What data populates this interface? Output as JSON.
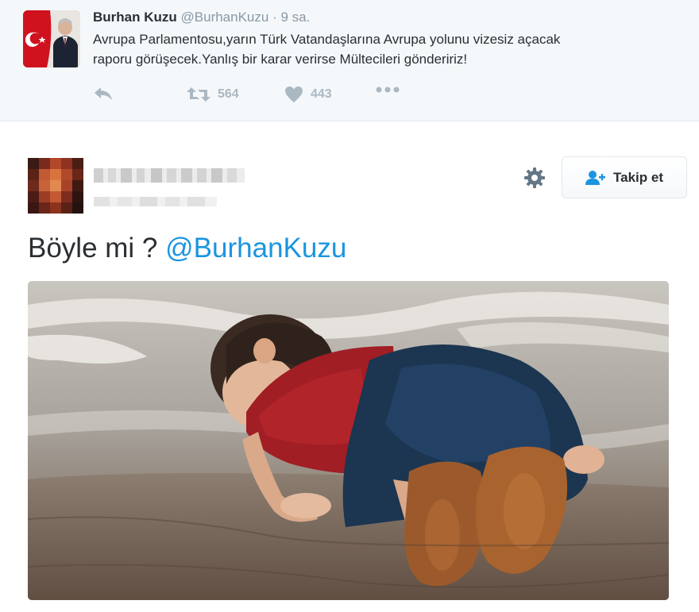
{
  "quoted_tweet": {
    "name": "Burhan Kuzu",
    "handle": "@BurhanKuzu",
    "separator": "·",
    "time": "9 sa.",
    "text_line1": "Avrupa Parlamentosu,yarın Türk Vatandaşlarına Avrupa yolunu vizesiz açacak",
    "text_line2": "raporu görüşecek.Yanlış bir karar verirse Mültecileri göndeririz!",
    "retweet_count": "564",
    "like_count": "443",
    "icons": [
      "reply-icon",
      "retweet-icon",
      "heart-icon",
      "more-icon"
    ]
  },
  "main_tweet": {
    "follow_label": "Takip et",
    "text": "Böyle mi ?",
    "mention": "@BurhanKuzu",
    "icons": [
      "gear-icon",
      "follow-user-icon"
    ]
  },
  "colors": {
    "link": "#1b95e0",
    "text": "#292f33",
    "muted": "#8899a6",
    "action_icon": "#aab8c2",
    "card_bg": "#f5f8fa"
  }
}
